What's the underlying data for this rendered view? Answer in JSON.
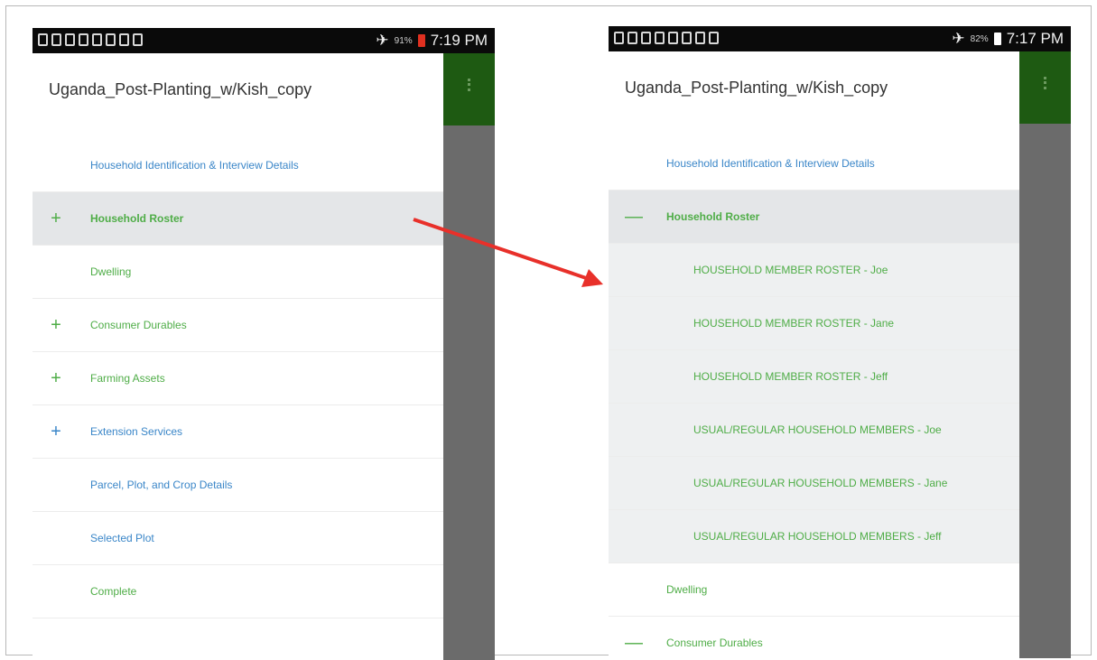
{
  "left_phone": {
    "status_time": "7:19 PM",
    "status_battery": "91%",
    "title": "Uganda_Post-Planting_w/Kish_copy",
    "items": [
      {
        "sign": "",
        "label": "Household Identification & Interview Details",
        "color": "#3a86c8"
      },
      {
        "sign": "+",
        "label": "Household Roster",
        "color": "#4fad47",
        "selected": true
      },
      {
        "sign": "",
        "label": "Dwelling",
        "color": "#4fad47"
      },
      {
        "sign": "+",
        "label": "Consumer Durables",
        "color": "#4fad47"
      },
      {
        "sign": "+",
        "label": "Farming Assets",
        "color": "#4fad47"
      },
      {
        "sign": "+",
        "label": "Extension Services",
        "color": "#3a86c8"
      },
      {
        "sign": "",
        "label": "Parcel, Plot, and Crop Details",
        "color": "#3a86c8"
      },
      {
        "sign": "",
        "label": "Selected Plot",
        "color": "#3a86c8"
      },
      {
        "sign": "",
        "label": "Complete",
        "color": "#4fad47"
      }
    ]
  },
  "right_phone": {
    "status_time": "7:17 PM",
    "status_battery": "82%",
    "title": "Uganda_Post-Planting_w/Kish_copy",
    "items": [
      {
        "sign": "",
        "label": "Household Identification & Interview Details",
        "color": "#3a86c8"
      },
      {
        "sign": "—",
        "label": "Household Roster",
        "color": "#4fad47",
        "selected": true
      },
      {
        "sign": "",
        "label": "HOUSEHOLD MEMBER ROSTER - Joe",
        "color": "#4fad47",
        "sub": true
      },
      {
        "sign": "",
        "label": "HOUSEHOLD MEMBER ROSTER - Jane",
        "color": "#4fad47",
        "sub": true
      },
      {
        "sign": "",
        "label": "HOUSEHOLD MEMBER ROSTER - Jeff",
        "color": "#4fad47",
        "sub": true
      },
      {
        "sign": "",
        "label": "USUAL/REGULAR  HOUSEHOLD MEMBERS - Joe",
        "color": "#4fad47",
        "sub": true
      },
      {
        "sign": "",
        "label": "USUAL/REGULAR  HOUSEHOLD MEMBERS - Jane",
        "color": "#4fad47",
        "sub": true
      },
      {
        "sign": "",
        "label": "USUAL/REGULAR  HOUSEHOLD MEMBERS - Jeff",
        "color": "#4fad47",
        "sub": true
      },
      {
        "sign": "",
        "label": "Dwelling",
        "color": "#4fad47"
      },
      {
        "sign": "—",
        "label": "Consumer Durables",
        "color": "#4fad47"
      }
    ]
  },
  "colors": {
    "accent_green": "#1e5a12",
    "arrow": "#e8302a",
    "battery_left": "#e03020",
    "battery_right": "#ffffff"
  }
}
